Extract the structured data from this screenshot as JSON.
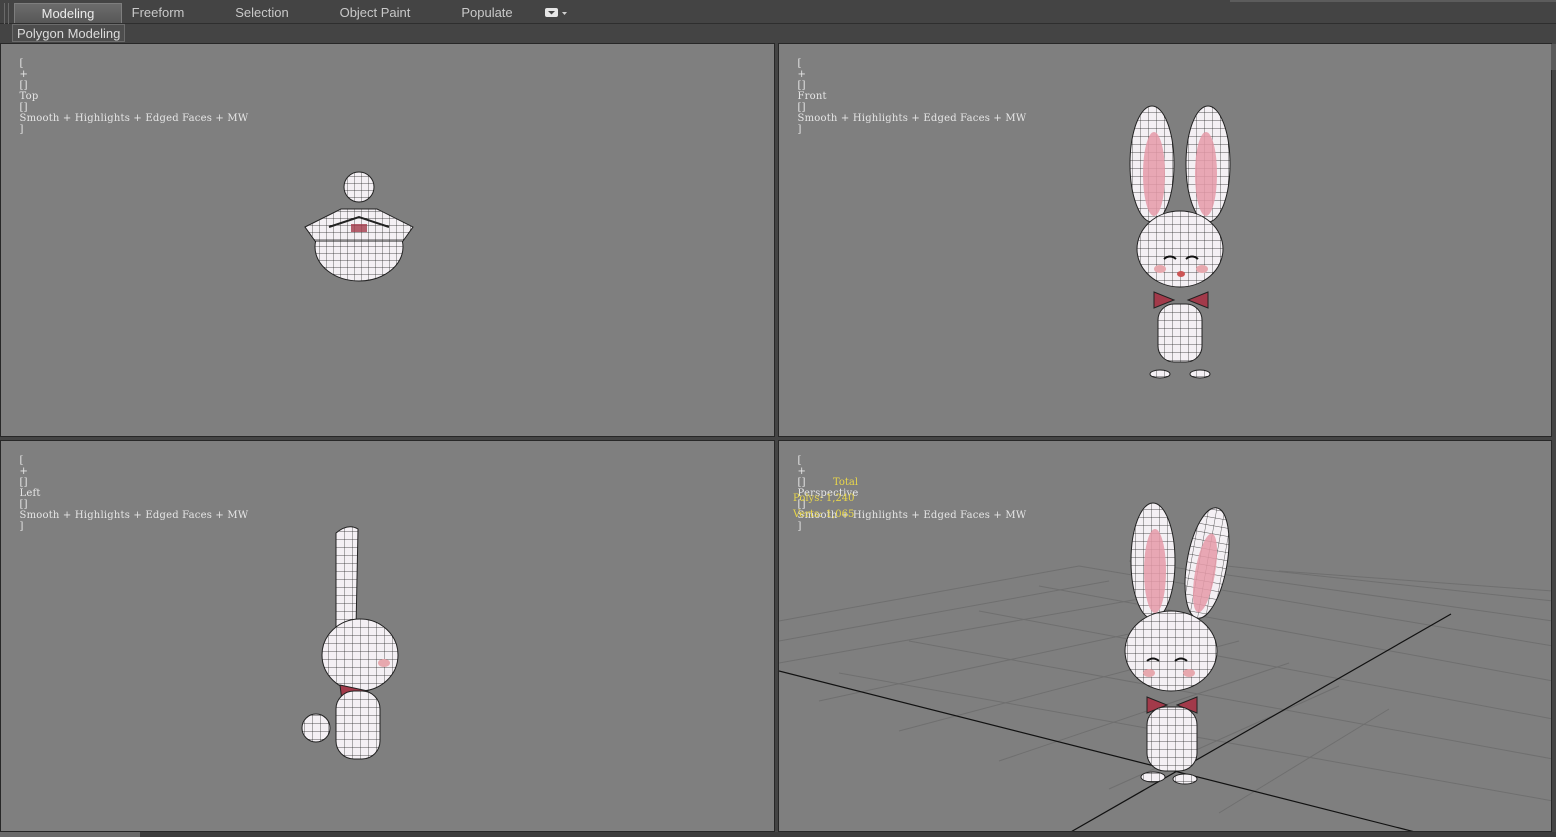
{
  "ribbon": {
    "tabs": [
      {
        "label": "Modeling",
        "active": true
      },
      {
        "label": "Freeform"
      },
      {
        "label": "Selection"
      },
      {
        "label": "Object Paint"
      },
      {
        "label": "Populate"
      }
    ],
    "options_icon": "dropdown-options-icon",
    "panel_label": "Polygon Modeling"
  },
  "viewports": [
    {
      "id": "top",
      "name": "Top"
    },
    {
      "id": "front",
      "name": "Front"
    },
    {
      "id": "left",
      "name": "Left"
    },
    {
      "id": "perspective",
      "name": "Perspective"
    }
  ],
  "label_parts": {
    "open": "[",
    "plus": "+",
    "divider": "[]",
    "shading": "Smooth + Highlights + Edged Faces + MW",
    "close": "]"
  },
  "stats": {
    "total_label": "Total",
    "polys": "Polys: 1,240",
    "verts": "Verts: 1,065"
  },
  "colors": {
    "viewport_bg": "#7f7f7f",
    "ui_bg": "#444444",
    "stats_text": "#e8d64a",
    "ear_inner": "#e59aa8",
    "bow": "#a23a4a"
  }
}
